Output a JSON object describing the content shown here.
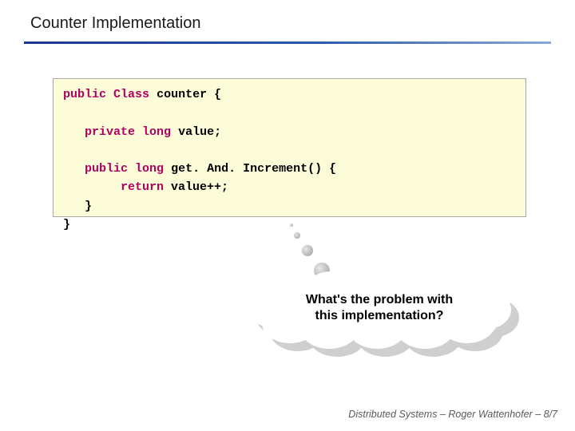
{
  "slide": {
    "title": "Counter Implementation"
  },
  "code": {
    "l1a": "public",
    "l1b": "Class",
    "l1c": "counter {",
    "l2a": "private",
    "l2b": "long",
    "l2c": "value;",
    "l3a": "public",
    "l3b": "long",
    "l3c": "get. And. Increment() {",
    "l4a": "return",
    "l4b": "value++;",
    "l5": "}",
    "l6": "}"
  },
  "callout": {
    "line1": "What's the problem with",
    "line2": "this implementation?"
  },
  "footer": {
    "text": "Distributed Systems  –  Roger Wattenhofer   – 8/7"
  }
}
